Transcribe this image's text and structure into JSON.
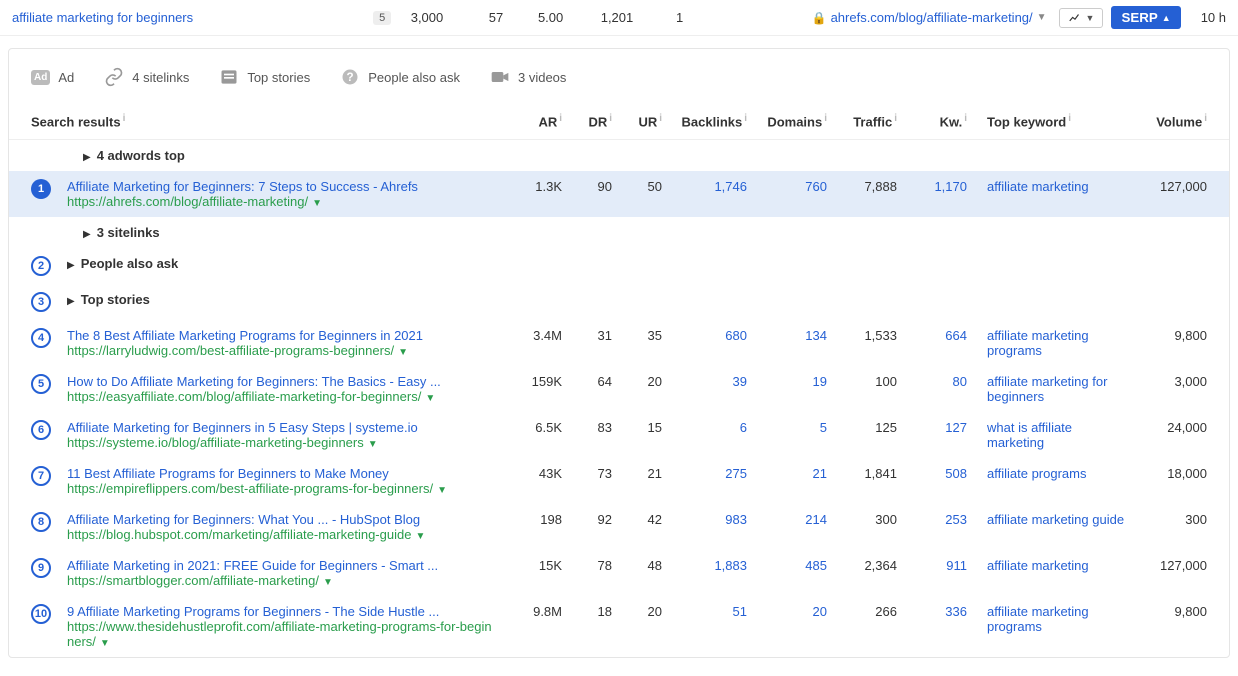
{
  "kw": {
    "text": "affiliate marketing for beginners",
    "badge": "5",
    "volume": "3,000",
    "kd": "57",
    "cpc": "5.00",
    "clicks": "1,201",
    "cps": "1",
    "site": "ahrefs.com/blog/affiliate-marketing/",
    "serp_btn": "SERP",
    "age": "10 h"
  },
  "features": {
    "ad": "Ad",
    "sitelinks": "4 sitelinks",
    "topstories": "Top stories",
    "paa": "People also ask",
    "videos": "3 videos"
  },
  "headers": {
    "results": "Search results",
    "ar": "AR",
    "dr": "DR",
    "ur": "UR",
    "backlinks": "Backlinks",
    "domains": "Domains",
    "traffic": "Traffic",
    "kw": "Kw.",
    "topkw": "Top keyword",
    "volume": "Volume"
  },
  "expand": {
    "adwords": "4 adwords top",
    "sitelinks": "3 sitelinks",
    "paa": "People also ask",
    "topstories": "Top stories"
  },
  "rows": [
    {
      "pos": "1",
      "title": "Affiliate Marketing for Beginners: 7 Steps to Success - Ahrefs",
      "url": "https://ahrefs.com/blog/affiliate-marketing/",
      "ar": "1.3K",
      "dr": "90",
      "ur": "50",
      "bl": "1,746",
      "dom": "760",
      "tr": "7,888",
      "kw": "1,170",
      "topkw": "affiliate marketing",
      "vol": "127,000",
      "hl": true
    },
    {
      "pos": "4",
      "title": "The 8 Best Affiliate Marketing Programs for Beginners in 2021",
      "url": "https://larryludwig.com/best-affiliate-programs-beginners/",
      "ar": "3.4M",
      "dr": "31",
      "ur": "35",
      "bl": "680",
      "dom": "134",
      "tr": "1,533",
      "kw": "664",
      "topkw": "affiliate marketing programs",
      "vol": "9,800"
    },
    {
      "pos": "5",
      "title": "How to Do Affiliate Marketing for Beginners: The Basics - Easy ...",
      "url": "https://easyaffiliate.com/blog/affiliate-marketing-for-beginners/",
      "ar": "159K",
      "dr": "64",
      "ur": "20",
      "bl": "39",
      "dom": "19",
      "tr": "100",
      "kw": "80",
      "topkw": "affiliate marketing for beginners",
      "vol": "3,000"
    },
    {
      "pos": "6",
      "title": "Affiliate Marketing for Beginners in 5 Easy Steps | systeme.io",
      "url": "https://systeme.io/blog/affiliate-marketing-beginners",
      "ar": "6.5K",
      "dr": "83",
      "ur": "15",
      "bl": "6",
      "dom": "5",
      "tr": "125",
      "kw": "127",
      "topkw": "what is affiliate marketing",
      "vol": "24,000"
    },
    {
      "pos": "7",
      "title": "11 Best Affiliate Programs for Beginners to Make Money",
      "url": "https://empireflippers.com/best-affiliate-programs-for-beginners/",
      "ar": "43K",
      "dr": "73",
      "ur": "21",
      "bl": "275",
      "dom": "21",
      "tr": "1,841",
      "kw": "508",
      "topkw": "affiliate programs",
      "vol": "18,000"
    },
    {
      "pos": "8",
      "title": "Affiliate Marketing for Beginners: What You ... - HubSpot Blog",
      "url": "https://blog.hubspot.com/marketing/affiliate-marketing-guide",
      "ar": "198",
      "dr": "92",
      "ur": "42",
      "bl": "983",
      "dom": "214",
      "tr": "300",
      "kw": "253",
      "topkw": "affiliate marketing guide",
      "vol": "300"
    },
    {
      "pos": "9",
      "title": "Affiliate Marketing in 2021: FREE Guide for Beginners - Smart ...",
      "url": "https://smartblogger.com/affiliate-marketing/",
      "ar": "15K",
      "dr": "78",
      "ur": "48",
      "bl": "1,883",
      "dom": "485",
      "tr": "2,364",
      "kw": "911",
      "topkw": "affiliate marketing",
      "vol": "127,000"
    },
    {
      "pos": "10",
      "title": "9 Affiliate Marketing Programs for Beginners - The Side Hustle ...",
      "url": "https://www.thesidehustleprofit.com/affiliate-marketing-programs-for-beginners/",
      "ar": "9.8M",
      "dr": "18",
      "ur": "20",
      "bl": "51",
      "dom": "20",
      "tr": "266",
      "kw": "336",
      "topkw": "affiliate marketing programs",
      "vol": "9,800"
    }
  ]
}
